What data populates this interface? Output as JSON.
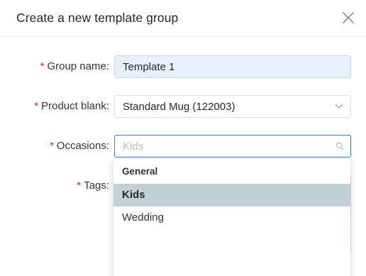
{
  "dialog": {
    "title": "Create a new template group"
  },
  "form": {
    "group_name": {
      "label": "Group name:",
      "value": "Template 1"
    },
    "product_blank": {
      "label": "Product blank:",
      "value": "Standard Mug (122003)"
    },
    "occasions": {
      "label": "Occasions:",
      "placeholder": "Kids"
    },
    "tags": {
      "label": "Tags:"
    },
    "required_mark": "*"
  },
  "dropdown": {
    "group_header": "General",
    "options": [
      {
        "label": "Kids",
        "highlighted": true
      },
      {
        "label": "Wedding",
        "highlighted": false
      }
    ]
  },
  "colors": {
    "accent": "#3a7bd5",
    "required": "#e5202b",
    "highlight": "#c3d1d6",
    "filled_input": "#e8f0fe"
  }
}
